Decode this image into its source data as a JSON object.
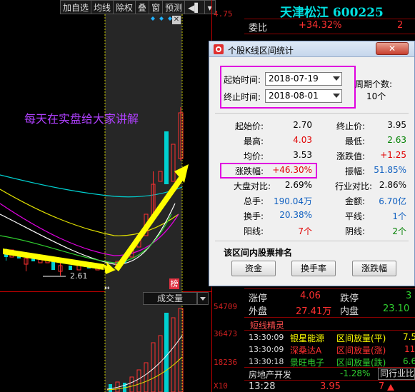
{
  "toolbar": {
    "items": [
      "加自选",
      "均线",
      "除权",
      "叠",
      "窗",
      "预测"
    ],
    "pin_icon": "pin-icon",
    "menu_icon": "dropdown-icon"
  },
  "chart": {
    "annotation": "每天在实盘给大家讲解",
    "low_label": "2.61",
    "tag_label": "榜",
    "volume_label": "成交量",
    "close_icon": "close-icon"
  },
  "axis": {
    "price_top": "4.75",
    "vol_labels": [
      "54709",
      "36473",
      "18236",
      "X10"
    ]
  },
  "quote": {
    "title": "天津松江 600225",
    "weibi_label": "委比",
    "weibi_value": "+34.32%",
    "weibi_extra": "2",
    "zhangting_label": "涨停",
    "zhangting_value": "4.06",
    "dieting_label": "跌停",
    "dieting_value": "3",
    "waipan_label": "外盘",
    "waipan_value": "27.41万",
    "neipan_label": "内盘",
    "neipan_value": "23.10",
    "sprite_title": "短线精灵",
    "sprite_rows": [
      {
        "time": "13:30:09",
        "name": "银星能源",
        "event": "区间放量(平)",
        "value": "7.5"
      },
      {
        "time": "13:30:09",
        "name": "深桑达A",
        "event": "区间放量(涨)",
        "value": "11"
      },
      {
        "time": "13:30:18",
        "name": "景旺电子",
        "event": "区间放量(跌)",
        "value": "6.6"
      }
    ],
    "sector_name": "房地产开发",
    "sector_change": "-1.28%",
    "sector_extra": "同行业比较",
    "bottom_time": "13:28",
    "bottom_price": "3.95",
    "bottom_vol": "7"
  },
  "dialog": {
    "title": "个股K线区间统计",
    "start_label": "起始时间:",
    "start_value": "2018-07-19",
    "end_label": "终止时间:",
    "end_value": "2018-08-01",
    "period_label": "周期个数:",
    "period_value": "10个",
    "stats": [
      {
        "label": "起始价:",
        "value": "2.70",
        "color": "#000",
        "label2": "终止价:",
        "value2": "3.95",
        "color2": "#000"
      },
      {
        "label": "最高:",
        "value": "4.03",
        "color": "#e00000",
        "label2": "最低:",
        "value2": "2.63",
        "color2": "#008000"
      },
      {
        "label": "均价:",
        "value": "3.53",
        "color": "#000",
        "label2": "涨跌值:",
        "value2": "+1.25",
        "color2": "#e00000"
      },
      {
        "label": "涨跌幅:",
        "value": "+46.30%",
        "color": "#e00000",
        "label2": "振幅:",
        "value2": "51.85%",
        "color2": "#1060c0"
      },
      {
        "label": "大盘对比:",
        "value": "2.69%",
        "color": "#000",
        "label2": "行业对比:",
        "value2": "2.86%",
        "color2": "#000"
      },
      {
        "label": "总手:",
        "value": "190.04万",
        "color": "#1060c0",
        "label2": "金额:",
        "value2": "6.70亿",
        "color2": "#1060c0"
      },
      {
        "label": "换手:",
        "value": "20.38%",
        "color": "#1060c0",
        "label2": "平线:",
        "value2": "1个",
        "color2": "#1060c0"
      },
      {
        "label": "阳线:",
        "value": "7个",
        "color": "#e00000",
        "label2": "阴线:",
        "value2": "2个",
        "color2": "#008000"
      }
    ],
    "ranking_title": "该区间内股票排名",
    "btn_funds": "资金",
    "btn_turnover": "换手率",
    "btn_change": "涨跌幅",
    "close_icon": "close-icon"
  }
}
